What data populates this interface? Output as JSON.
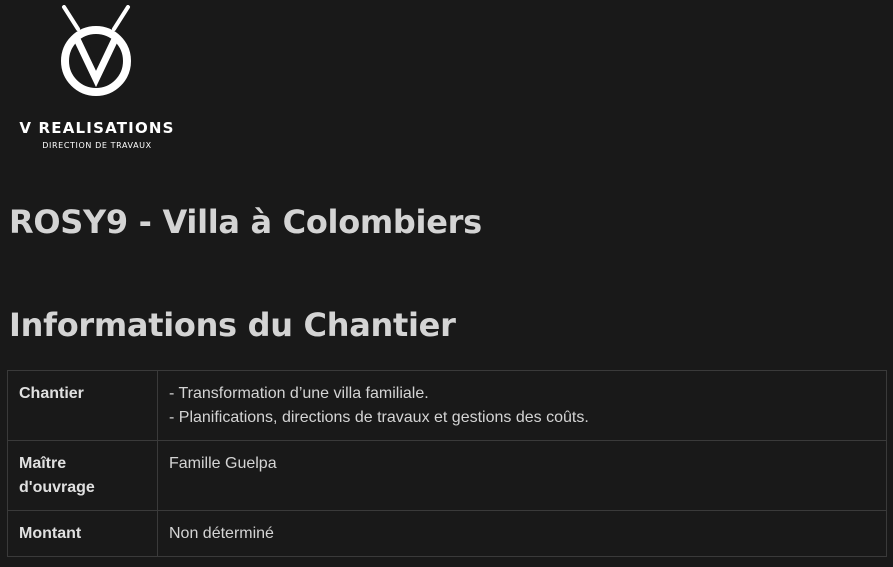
{
  "brand": {
    "name": "V REALISATIONS",
    "tagline": "DIRECTION DE TRAVAUX",
    "logo_icon": "v-compass-logo",
    "text_color": "#ffffff"
  },
  "page_title": "ROSY9 - Villa à Colombiers",
  "section_title": "Informations du Chantier",
  "table": {
    "rows": [
      {
        "label": "Chantier",
        "value_lines": [
          "- Transformation d’une villa familiale.",
          "- Planifications, directions de travaux et gestions des coûts."
        ]
      },
      {
        "label": "Maître d'ouvrage",
        "value_lines": [
          "Famille Guelpa"
        ]
      },
      {
        "label": "Montant",
        "value_lines": [
          "Non déterminé"
        ]
      }
    ]
  },
  "colors": {
    "background": "#191919",
    "text": "#d4d4d4",
    "border": "#3a3a3a"
  }
}
